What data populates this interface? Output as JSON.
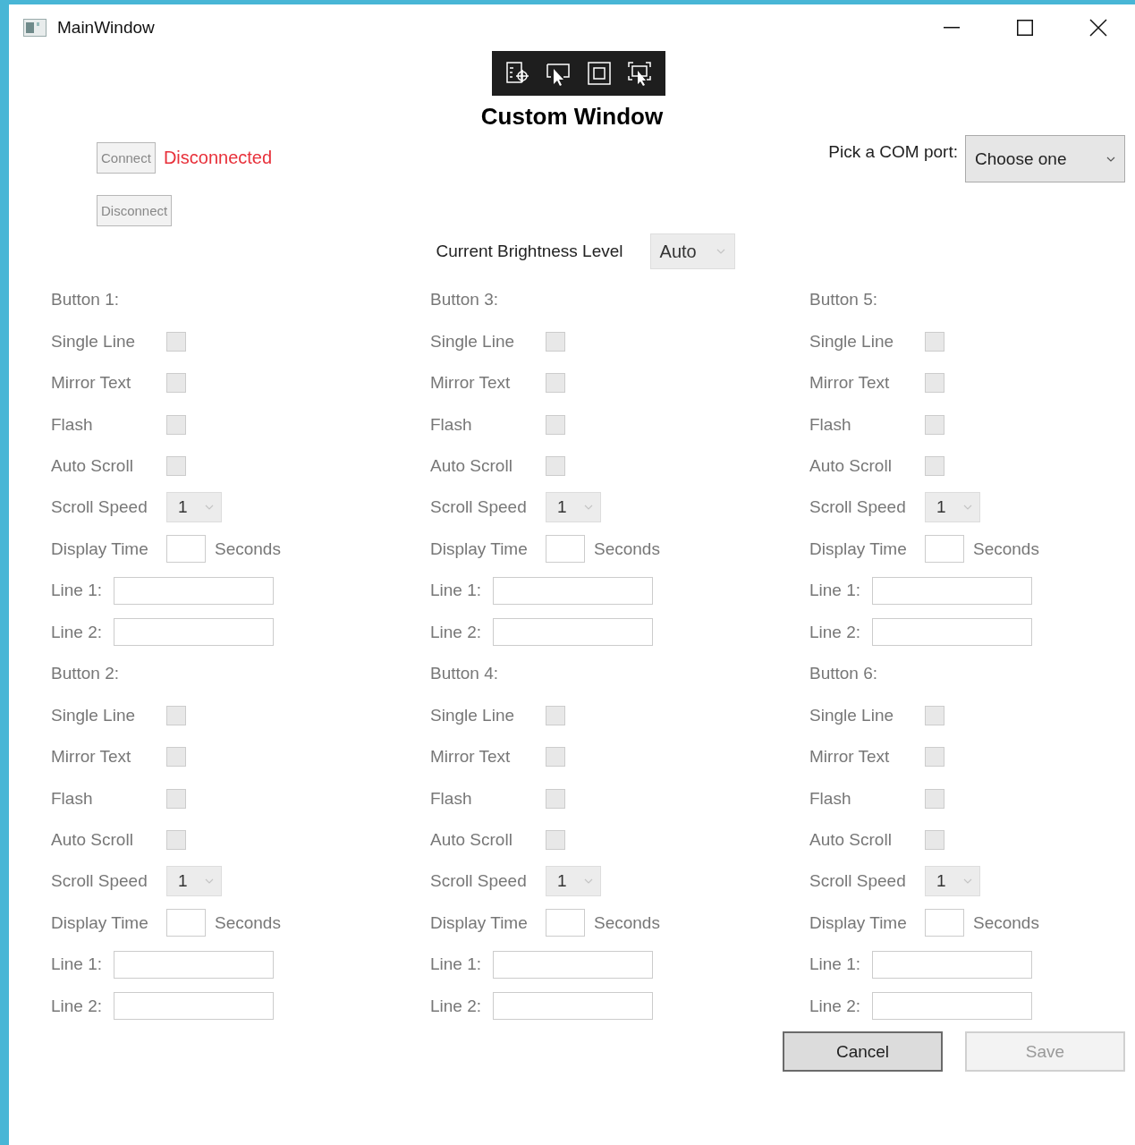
{
  "window": {
    "title": "MainWindow"
  },
  "heading": "Custom Window",
  "connection": {
    "connect_button": {
      "label": "Connect",
      "disabled": true
    },
    "status": "Disconnected",
    "disconnect_button": {
      "label": "Disconnect",
      "disabled": true
    }
  },
  "com_port": {
    "label": "Pick a COM port:",
    "value": "Choose one"
  },
  "brightness": {
    "label": "Current Brightness Level",
    "value": "Auto",
    "disabled": true
  },
  "button_groups": [
    {
      "title": "Button 1:",
      "disabled": true,
      "options": [
        {
          "label": "Single Line",
          "checked": false
        },
        {
          "label": "Mirror Text",
          "checked": false
        },
        {
          "label": "Flash",
          "checked": false
        },
        {
          "label": "Auto Scroll",
          "checked": false
        }
      ],
      "scroll_speed": {
        "label": "Scroll Speed",
        "value": "1"
      },
      "display_time": {
        "label": "Display Time",
        "unit": "Seconds"
      },
      "lines": [
        {
          "label": "Line 1:"
        },
        {
          "label": "Line 2:"
        }
      ]
    },
    {
      "title": "Button 2:",
      "disabled": true,
      "options": [
        {
          "label": "Single Line",
          "checked": false
        },
        {
          "label": "Mirror Text",
          "checked": false
        },
        {
          "label": "Flash",
          "checked": false
        },
        {
          "label": "Auto Scroll",
          "checked": false
        }
      ],
      "scroll_speed": {
        "label": "Scroll Speed",
        "value": "1"
      },
      "display_time": {
        "label": "Display Time",
        "unit": "Seconds"
      },
      "lines": [
        {
          "label": "Line 1:"
        },
        {
          "label": "Line 2:"
        }
      ]
    },
    {
      "title": "Button 3:",
      "disabled": true,
      "options": [
        {
          "label": "Single Line",
          "checked": false
        },
        {
          "label": "Mirror Text",
          "checked": false
        },
        {
          "label": "Flash",
          "checked": false
        },
        {
          "label": "Auto Scroll",
          "checked": false
        }
      ],
      "scroll_speed": {
        "label": "Scroll Speed",
        "value": "1"
      },
      "display_time": {
        "label": "Display Time",
        "unit": "Seconds"
      },
      "lines": [
        {
          "label": "Line 1:"
        },
        {
          "label": "Line 2:"
        }
      ]
    },
    {
      "title": "Button 4:",
      "disabled": true,
      "options": [
        {
          "label": "Single Line",
          "checked": false
        },
        {
          "label": "Mirror Text",
          "checked": false
        },
        {
          "label": "Flash",
          "checked": false
        },
        {
          "label": "Auto Scroll",
          "checked": false
        }
      ],
      "scroll_speed": {
        "label": "Scroll Speed",
        "value": "1"
      },
      "display_time": {
        "label": "Display Time",
        "unit": "Seconds"
      },
      "lines": [
        {
          "label": "Line 1:"
        },
        {
          "label": "Line 2:"
        }
      ]
    },
    {
      "title": "Button 5:",
      "disabled": true,
      "options": [
        {
          "label": "Single Line",
          "checked": false
        },
        {
          "label": "Mirror Text",
          "checked": false
        },
        {
          "label": "Flash",
          "checked": false
        },
        {
          "label": "Auto Scroll",
          "checked": false
        }
      ],
      "scroll_speed": {
        "label": "Scroll Speed",
        "value": "1"
      },
      "display_time": {
        "label": "Display Time",
        "unit": "Seconds"
      },
      "lines": [
        {
          "label": "Line 1:"
        },
        {
          "label": "Line 2:"
        }
      ]
    },
    {
      "title": "Button 6:",
      "disabled": true,
      "options": [
        {
          "label": "Single Line",
          "checked": false
        },
        {
          "label": "Mirror Text",
          "checked": false
        },
        {
          "label": "Flash",
          "checked": false
        },
        {
          "label": "Auto Scroll",
          "checked": false
        }
      ],
      "scroll_speed": {
        "label": "Scroll Speed",
        "value": "1"
      },
      "display_time": {
        "label": "Display Time",
        "unit": "Seconds"
      },
      "lines": [
        {
          "label": "Line 1:"
        },
        {
          "label": "Line 2:"
        }
      ]
    }
  ],
  "footer_buttons": [
    {
      "label": "Cancel",
      "disabled": false
    },
    {
      "label": "Save",
      "disabled": true
    }
  ]
}
